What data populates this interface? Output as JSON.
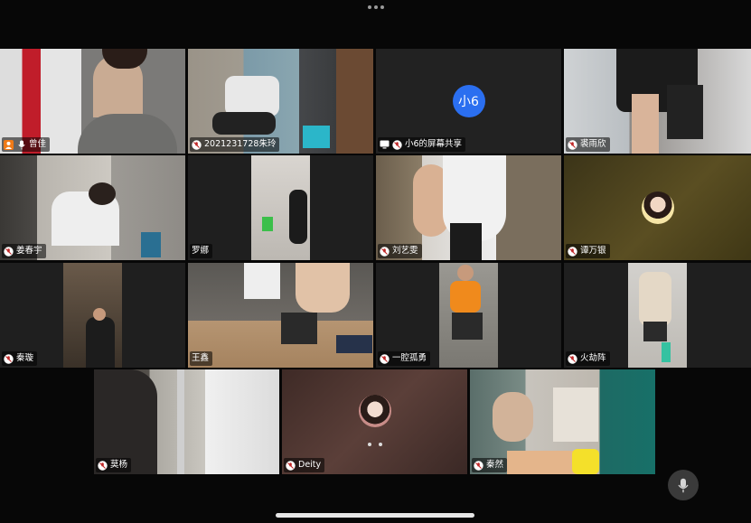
{
  "colors": {
    "background": "#070707",
    "tile": "#1f1f1f",
    "host_badge": "#f07a17",
    "share_avatar": "#2b6ff0"
  },
  "participants": [
    {
      "name": "曾佳",
      "icon": "host-badge-icon"
    },
    {
      "name": "2021231728朱玲",
      "icon": "muted-mic-icon"
    },
    {
      "name": "小6的屏幕共享",
      "icon": "screen-share-icon",
      "avatar_text": "小6"
    },
    {
      "name": "裘雨欣",
      "icon": "muted-mic-icon"
    },
    {
      "name": "姜春宇",
      "icon": "muted-mic-icon"
    },
    {
      "name": "罗娜",
      "icon": "none"
    },
    {
      "name": "刘艺雯",
      "icon": "muted-mic-icon"
    },
    {
      "name": "谭万银",
      "icon": "muted-mic-icon"
    },
    {
      "name": "秦璇",
      "icon": "muted-mic-icon"
    },
    {
      "name": "王鑫",
      "icon": "none"
    },
    {
      "name": "一腔孤勇",
      "icon": "muted-mic-icon"
    },
    {
      "name": "火劫阵",
      "icon": "muted-mic-icon"
    },
    {
      "name": "莫杨",
      "icon": "muted-mic-icon"
    },
    {
      "name": "Deity",
      "icon": "muted-mic-icon"
    },
    {
      "name": "秦然",
      "icon": "muted-mic-icon"
    }
  ],
  "controls": {
    "mic": "microphone-icon"
  }
}
